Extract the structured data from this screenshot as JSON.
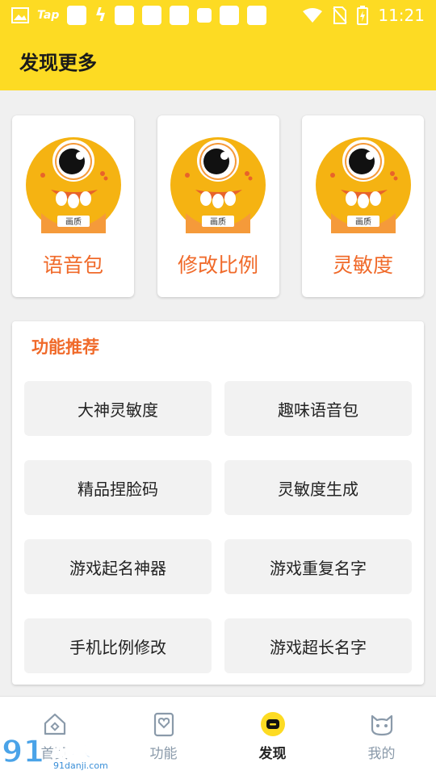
{
  "status_bar": {
    "app_label": "Tap",
    "time": "11:21"
  },
  "header": {
    "title": "发现更多"
  },
  "top_cards": [
    {
      "label": "语音包",
      "badge": "画质"
    },
    {
      "label": "修改比例",
      "badge": "画质"
    },
    {
      "label": "灵敏度",
      "badge": "画质"
    }
  ],
  "recommend": {
    "title": "功能推荐",
    "items": [
      "大神灵敏度",
      "趣味语音包",
      "精品捏脸码",
      "灵敏度生成",
      "游戏起名神器",
      "游戏重复名字",
      "手机比例修改",
      "游戏超长名字"
    ]
  },
  "bottom_nav": [
    {
      "label": "首页",
      "icon": "home-icon",
      "active": false
    },
    {
      "label": "功能",
      "icon": "heart-tablet-icon",
      "active": false
    },
    {
      "label": "发现",
      "icon": "discover-icon",
      "active": true
    },
    {
      "label": "我的",
      "icon": "cat-face-icon",
      "active": false
    }
  ],
  "watermark": {
    "text": "游戏",
    "number": "91",
    "url": "91danji.com"
  },
  "colors": {
    "brand_yellow": "#fddb23",
    "accent_orange": "#f06a2a",
    "background": "#f0f0f0"
  }
}
